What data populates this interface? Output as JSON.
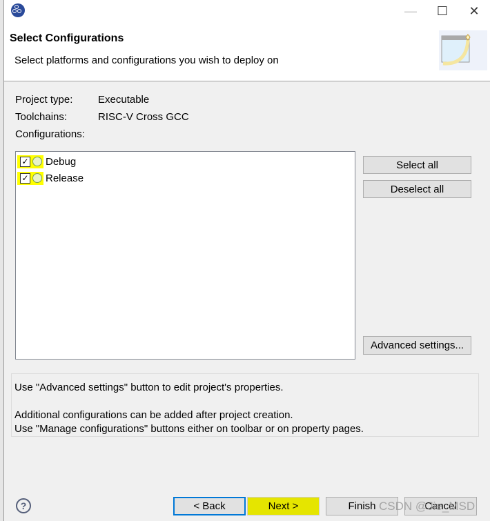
{
  "window": {
    "minimize": "—",
    "maximize": "☐",
    "close": "✕"
  },
  "header": {
    "title": "Select Configurations",
    "subtitle": "Select platforms and configurations you wish to deploy on"
  },
  "info": [
    {
      "label": "Project type:",
      "value": "Executable"
    },
    {
      "label": "Toolchains:",
      "value": "RISC-V Cross GCC"
    }
  ],
  "configs_label": "Configurations:",
  "configs": [
    {
      "name": "Debug",
      "checked": true
    },
    {
      "name": "Release",
      "checked": true
    }
  ],
  "side_buttons": {
    "select_all": "Select all",
    "deselect_all": "Deselect all",
    "advanced": "Advanced settings..."
  },
  "note": {
    "line1": "Use \"Advanced settings\" button to edit project's properties.",
    "line2": "Additional configurations can be added after project creation.",
    "line3": "Use \"Manage configurations\" buttons either on toolbar or on property pages."
  },
  "footer": {
    "help": "?",
    "back": "< Back",
    "next": "Next >",
    "finish": "Finish",
    "cancel": "Cancel"
  },
  "watermark": "CSDN @Jie_MSD",
  "colors": {
    "highlight": "#ffff00",
    "focus": "#0078d7"
  }
}
